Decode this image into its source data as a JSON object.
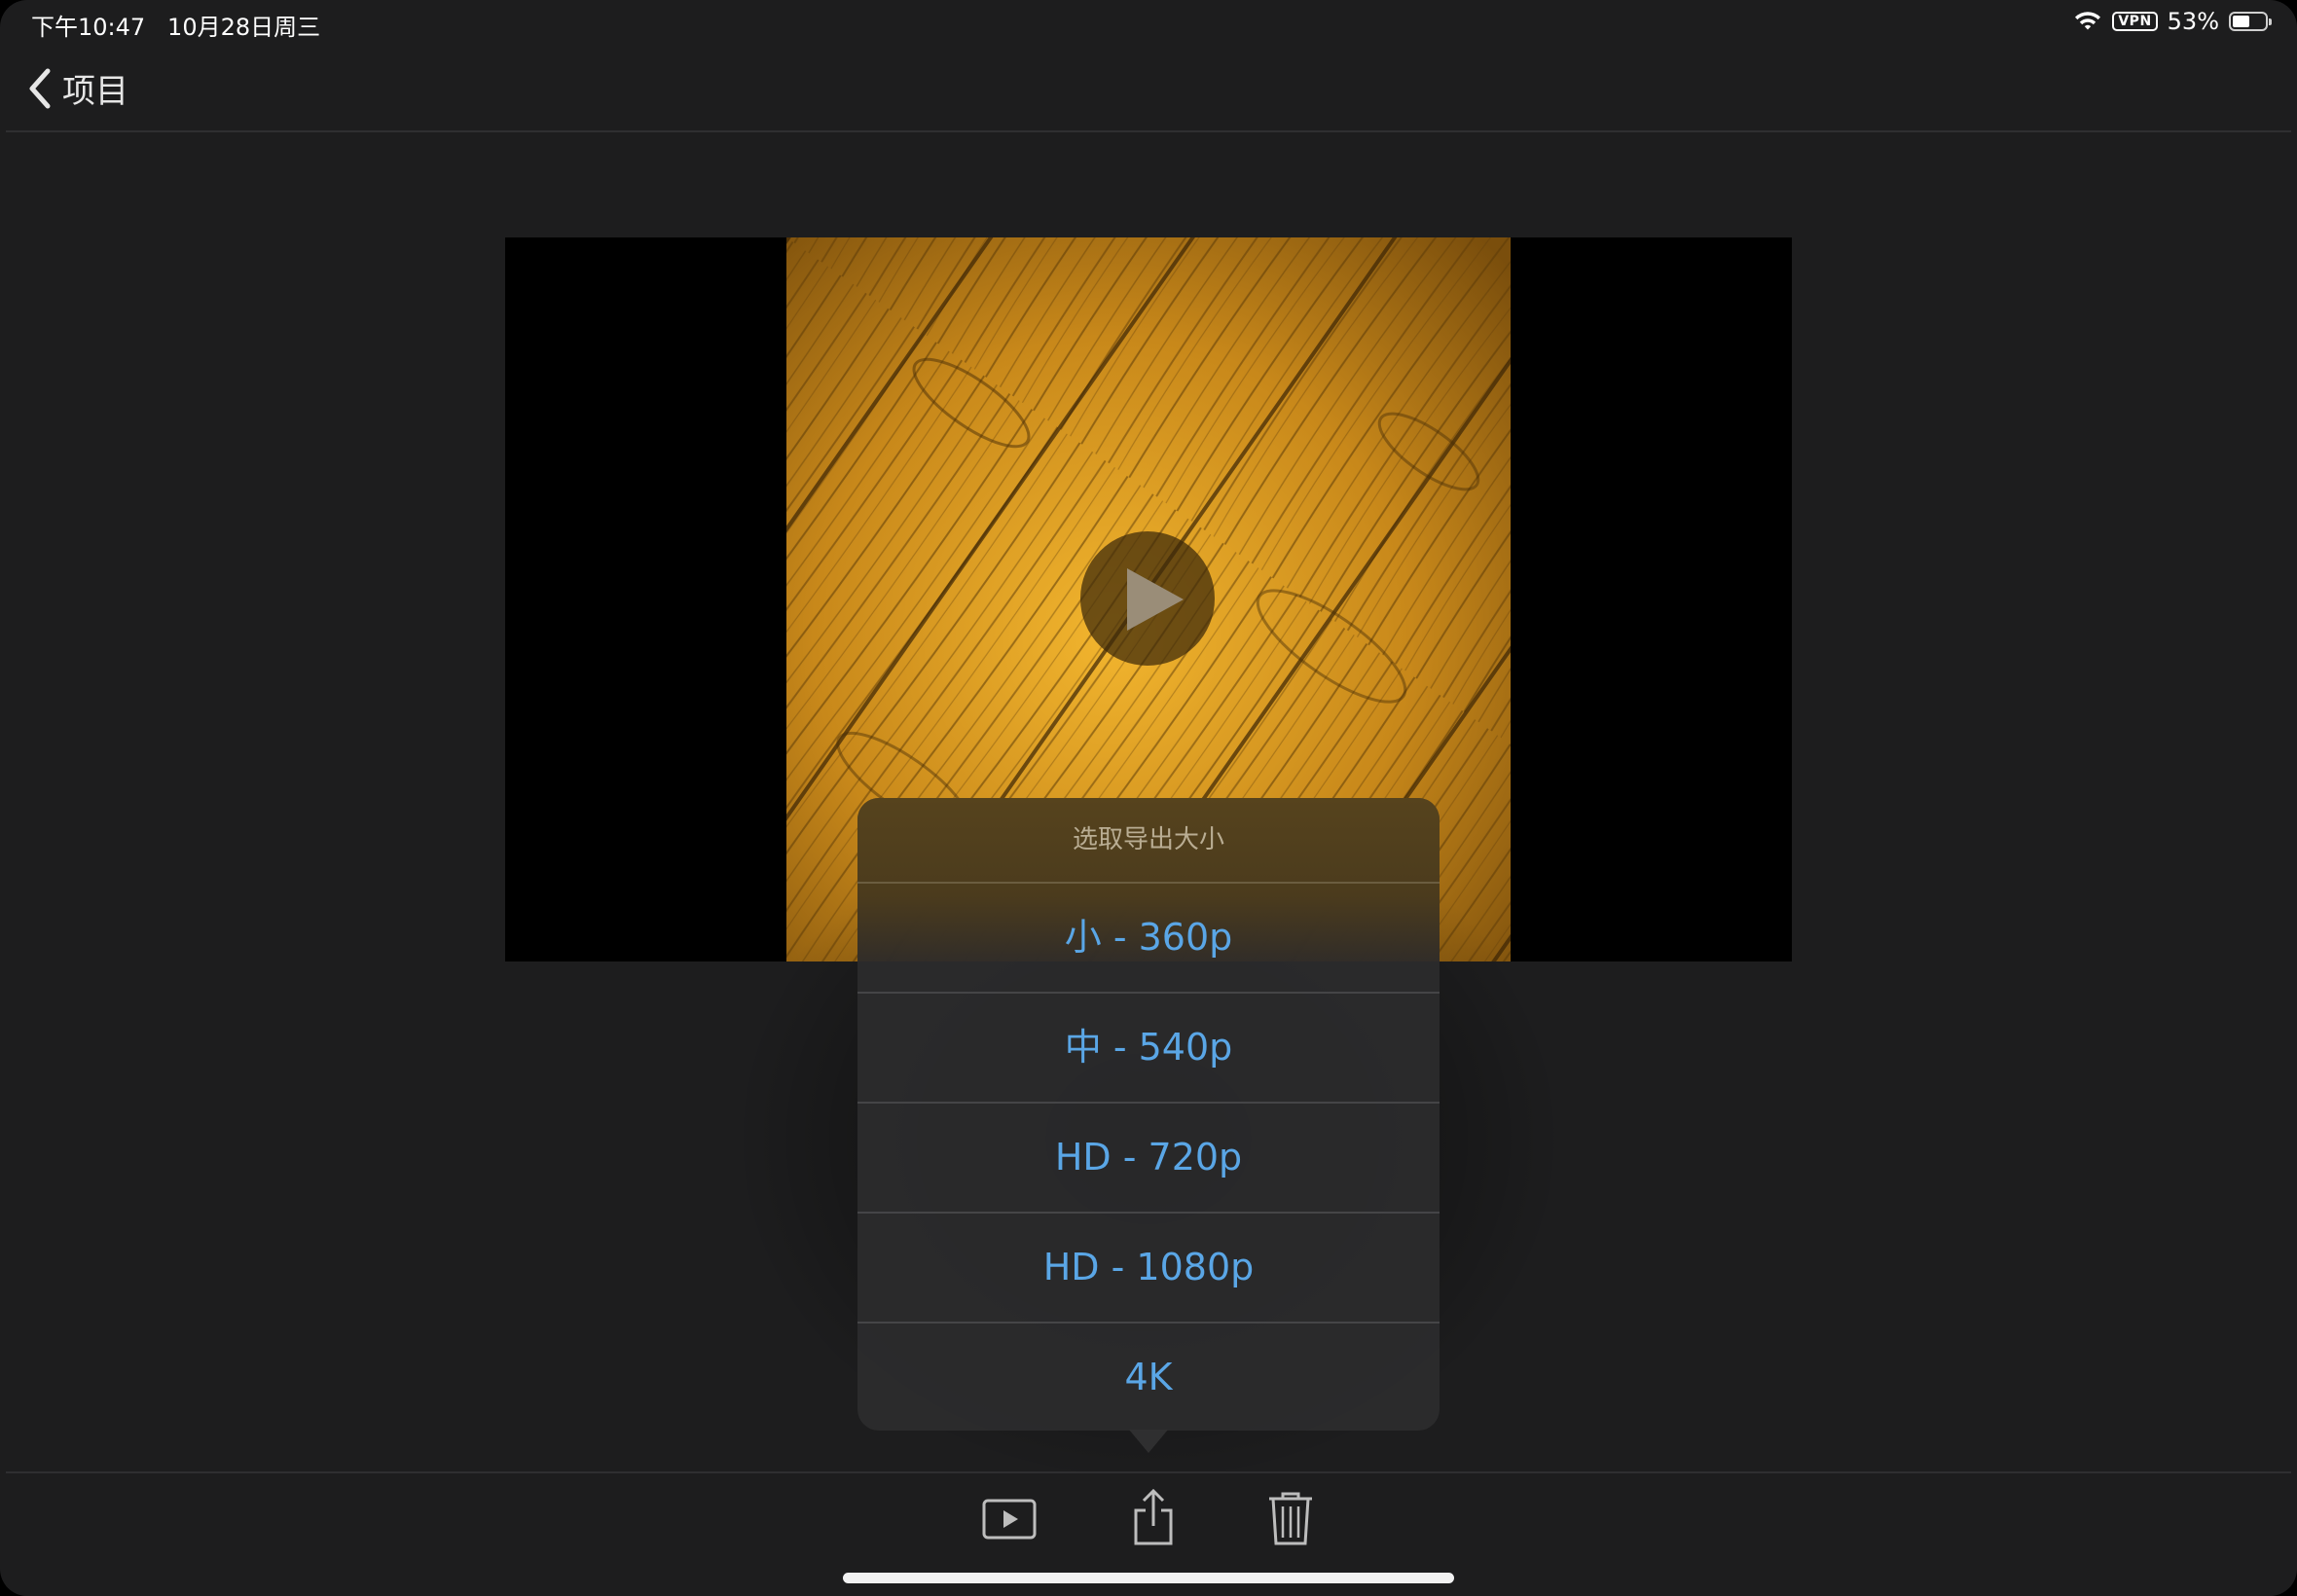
{
  "status_bar": {
    "time": "下午10:47   10月28日周三",
    "vpn": "VPN",
    "battery": "53%",
    "battery_level": 0.53
  },
  "nav": {
    "back_label": "项目"
  },
  "preview": {
    "thumbnail_subject": "wood-floor",
    "play_icon": "play-icon"
  },
  "export_popover": {
    "title": "选取导出大小",
    "options": [
      {
        "label": "小 - 360p"
      },
      {
        "label": "中 - 540p"
      },
      {
        "label": "HD - 720p"
      },
      {
        "label": "HD - 1080p"
      },
      {
        "label": "4K"
      }
    ]
  },
  "toolbar": {
    "icons": [
      "play-movie-icon",
      "share-icon",
      "trash-icon"
    ]
  },
  "colors": {
    "background": "#1d1d1e",
    "accent": "#5aa6e6",
    "popover_title": "#b9ad93"
  }
}
